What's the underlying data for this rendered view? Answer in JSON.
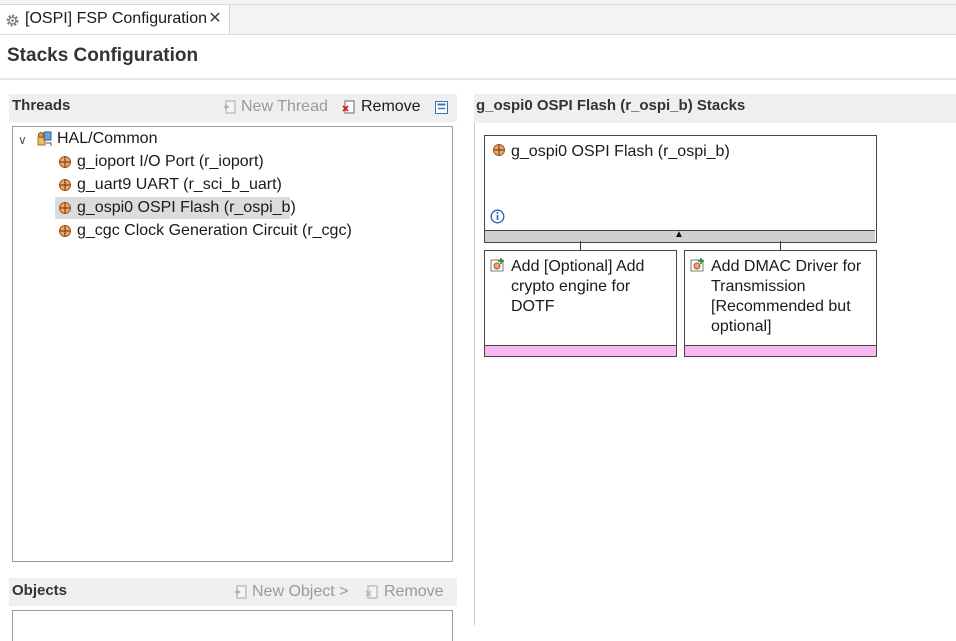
{
  "tab": {
    "label": "[OSPI] FSP Configuration",
    "close_glyph": "✕"
  },
  "page": {
    "title": "Stacks Configuration"
  },
  "threads": {
    "header": "Threads",
    "new_thread": "New Thread",
    "remove": "Remove",
    "tree": {
      "root": "HAL/Common",
      "items": [
        "g_ioport I/O Port (r_ioport)",
        "g_uart9 UART (r_sci_b_uart)",
        "g_ospi0 OSPI Flash (r_ospi_b)",
        "g_cgc Clock Generation Circuit (r_cgc)"
      ],
      "selected_index": 2
    }
  },
  "objects": {
    "header": "Objects",
    "new_object": "New Object >",
    "remove": "Remove"
  },
  "stacks": {
    "title": "g_ospi0 OSPI Flash (r_ospi_b) Stacks",
    "main_module": "g_ospi0 OSPI Flash (r_ospi_b)",
    "sub_modules": [
      "Add [Optional] Add crypto engine for DOTF",
      "Add DMAC Driver for Transmission [Recommended but optional]"
    ]
  },
  "colors": {
    "optional_bar": "#f8b9f0",
    "selection": "#dcdcdc",
    "header_bg": "#efefef"
  }
}
